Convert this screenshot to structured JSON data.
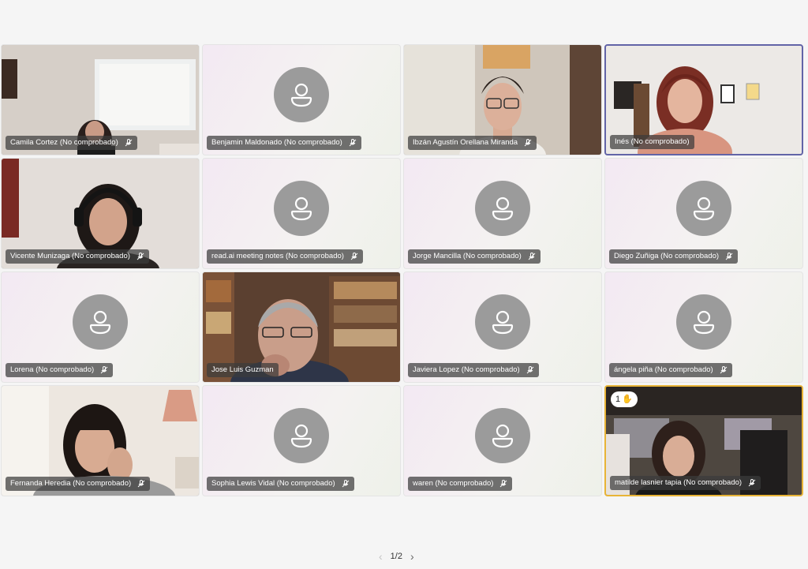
{
  "participants": [
    {
      "name": "Camila Cortez (No comprobado)",
      "muted": true,
      "video": true
    },
    {
      "name": "Benjamin Maldonado (No comprobado)",
      "muted": true,
      "video": false
    },
    {
      "name": "Ibzán Agustín Orellana Miranda",
      "muted": true,
      "video": true
    },
    {
      "name": "Inés (No comprobado)",
      "muted": false,
      "video": true,
      "speaking": true
    },
    {
      "name": "Vicente Munizaga (No comprobado)",
      "muted": true,
      "video": true
    },
    {
      "name": "read.ai meeting notes (No comprobado)",
      "muted": true,
      "video": false
    },
    {
      "name": "Jorge Mancilla (No comprobado)",
      "muted": true,
      "video": false
    },
    {
      "name": "Diego Zuñiga (No comprobado)",
      "muted": true,
      "video": false
    },
    {
      "name": "Lorena (No comprobado)",
      "muted": true,
      "video": false
    },
    {
      "name": "Jose Luis Guzman",
      "muted": false,
      "video": true
    },
    {
      "name": "Javiera Lopez (No comprobado)",
      "muted": true,
      "video": false
    },
    {
      "name": "ángela piña (No comprobado)",
      "muted": true,
      "video": false
    },
    {
      "name": "Fernanda Heredia (No comprobado)",
      "muted": true,
      "video": true
    },
    {
      "name": "Sophia Lewis Vidal (No comprobado)",
      "muted": true,
      "video": false
    },
    {
      "name": "waren (No comprobado)",
      "muted": true,
      "video": false
    },
    {
      "name": "matilde lasnier tapia (No comprobado)",
      "muted": true,
      "video": true,
      "hand_raised": true
    }
  ],
  "hand_badge": {
    "count": "1",
    "icon": "raised-hand-icon"
  },
  "pager": {
    "label": "1/2",
    "prev_icon": "chevron-left-icon",
    "next_icon": "chevron-right-icon"
  },
  "colors": {
    "speaking_border": "#6264a7",
    "hand_border": "#e8b437",
    "avatar_bg": "#9b9b9b"
  }
}
